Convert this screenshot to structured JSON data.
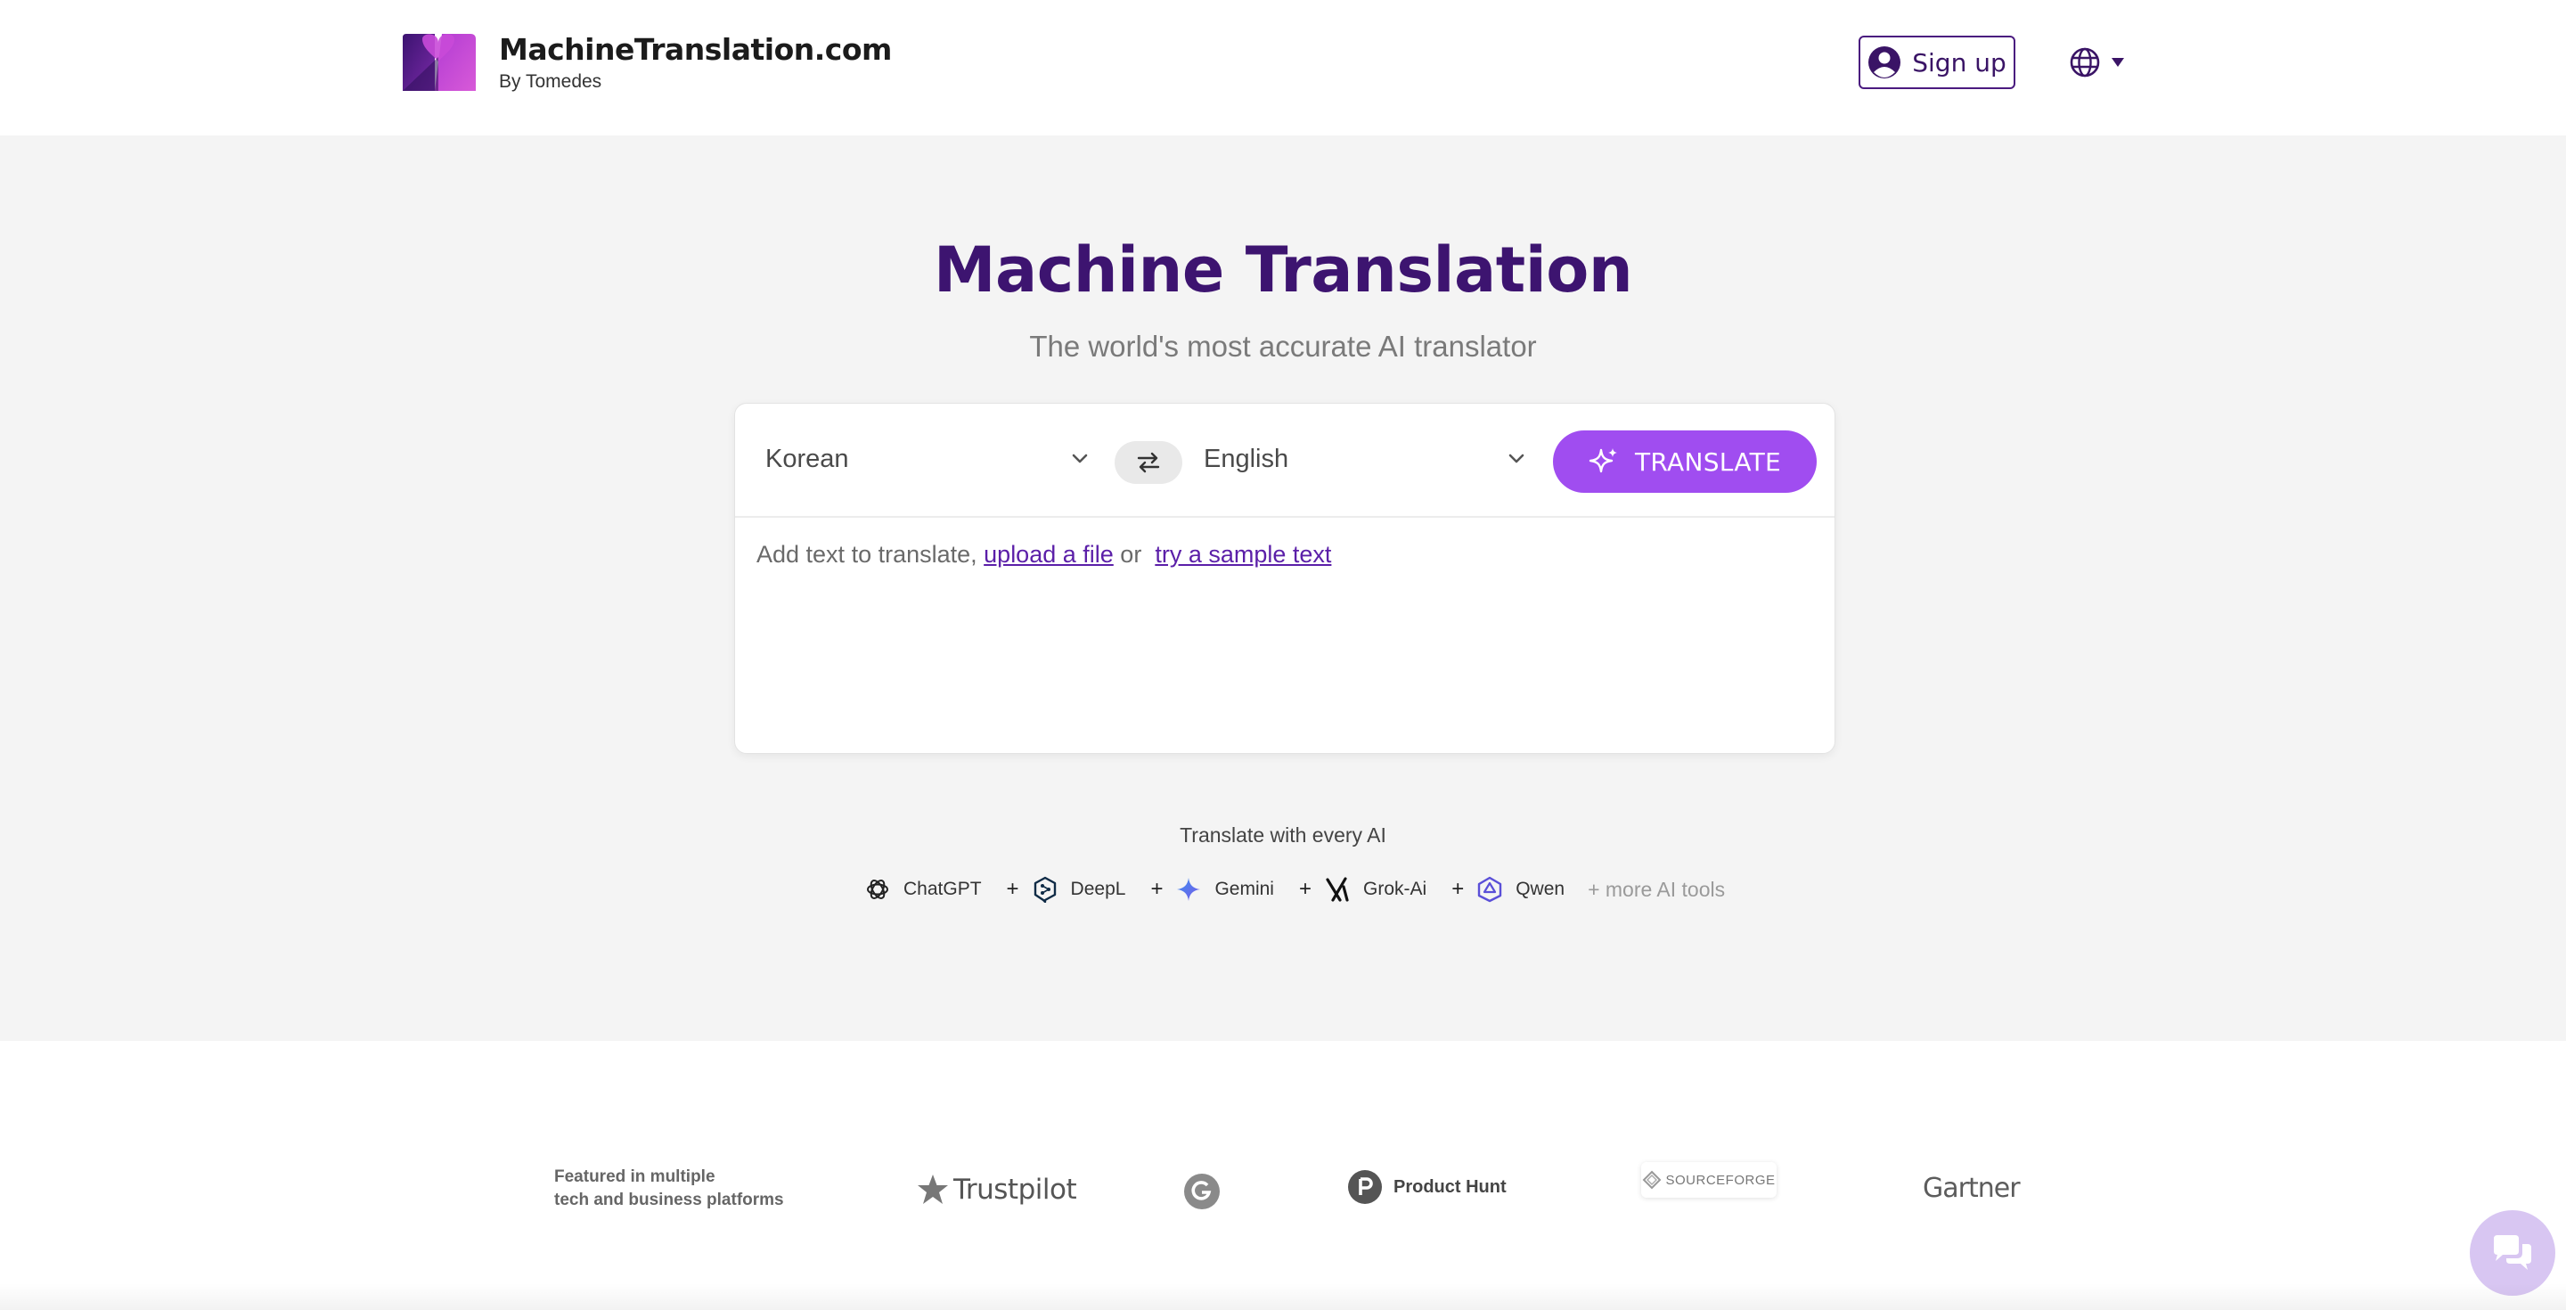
{
  "header": {
    "brand_title": "MachineTranslation.com",
    "brand_sub": "By Tomedes",
    "signup_label": "Sign up",
    "language_menu_icon": "globe-icon"
  },
  "hero": {
    "title": "Machine Translation",
    "subtitle": "The world's most accurate AI translator"
  },
  "translator": {
    "source_language": "Korean",
    "target_language": "English",
    "translate_label": "TRANSLATE",
    "prompt_prefix": "Add text to translate,",
    "upload_link": "upload a file",
    "or_text": "or",
    "sample_link": "try a sample text"
  },
  "ai_tools": {
    "heading": "Translate with every AI",
    "items": [
      {
        "label": "ChatGPT",
        "icon": "chatgpt-icon"
      },
      {
        "label": "DeepL",
        "icon": "deepl-icon"
      },
      {
        "label": "Gemini",
        "icon": "gemini-icon"
      },
      {
        "label": "Grok-Ai",
        "icon": "grok-icon"
      },
      {
        "label": "Qwen",
        "icon": "qwen-icon"
      }
    ],
    "plus": "+",
    "more": "+ more AI tools"
  },
  "featured": {
    "line1": "Featured in multiple",
    "line2": "tech and business platforms",
    "brands": {
      "trustpilot": "Trustpilot",
      "producthunt": "Product Hunt",
      "sourceforge": "SOURCEFORGE",
      "gartner": "Gartner"
    }
  },
  "colors": {
    "brand_purple": "#3d1470",
    "accent": "#a04df0",
    "link": "#5b1fa8",
    "hero_bg": "#f4f4f4"
  }
}
